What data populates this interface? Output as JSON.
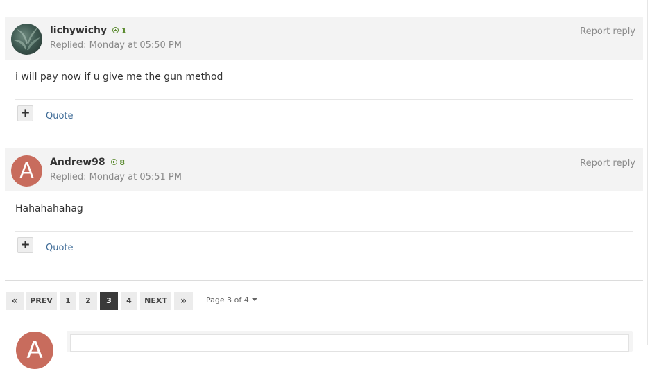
{
  "posts": [
    {
      "username": "lichywichy",
      "reputation": "1",
      "replied": "Replied: Monday at 05:50 PM",
      "report_label": "Report reply",
      "body": "i will pay now if u give me the gun method",
      "plus_label": "+",
      "quote_label": "Quote",
      "avatar_type": "photo"
    },
    {
      "username": "Andrew98",
      "reputation": "8",
      "replied": "Replied: Monday at 05:51 PM",
      "report_label": "Report reply",
      "body": "Hahahahahag",
      "plus_label": "+",
      "quote_label": "Quote",
      "avatar_type": "letter",
      "avatar_letter": "A",
      "avatar_color": "#c86c5d"
    }
  ],
  "pagination": {
    "first_label": "«",
    "prev_label": "PREV",
    "pages": [
      "1",
      "2",
      "3",
      "4"
    ],
    "current_page": "3",
    "next_label": "NEXT",
    "last_label": "»",
    "page_info": "Page 3 of 4"
  },
  "reply_box": {
    "avatar_letter": "A"
  },
  "colors": {
    "reputation": "#5a8a2e",
    "link": "#3d6a96",
    "header_bg": "#f3f3f3",
    "active_page_bg": "#3a3a3a"
  }
}
